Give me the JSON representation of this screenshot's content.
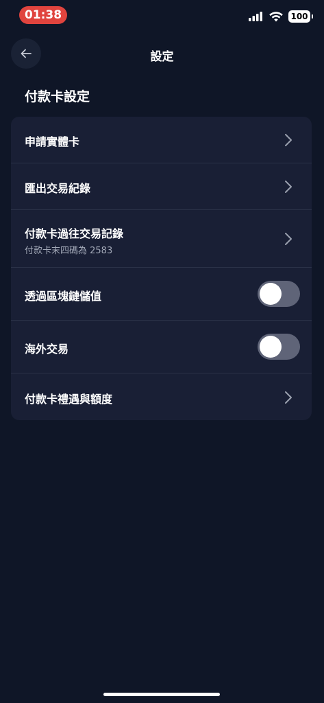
{
  "status_bar": {
    "time": "01:38",
    "battery": "100"
  },
  "header": {
    "title": "設定",
    "back_icon": "arrow-left-icon"
  },
  "section": {
    "title": "付款卡設定"
  },
  "settings": {
    "rows": [
      {
        "label": "申請實體卡",
        "type": "link"
      },
      {
        "label": "匯出交易紀錄",
        "type": "link"
      },
      {
        "label": "付款卡過往交易記錄",
        "subtitle": "付款卡末四碼為 2583",
        "type": "link"
      },
      {
        "label": "透過區塊鏈儲值",
        "type": "toggle",
        "enabled": false
      },
      {
        "label": "海外交易",
        "type": "toggle",
        "enabled": false
      },
      {
        "label": "付款卡禮遇與額度",
        "type": "link"
      }
    ]
  },
  "colors": {
    "background": "#0f1627",
    "card": "#191f35",
    "time_pill": "#e0443e",
    "toggle_off": "#5f6478"
  }
}
